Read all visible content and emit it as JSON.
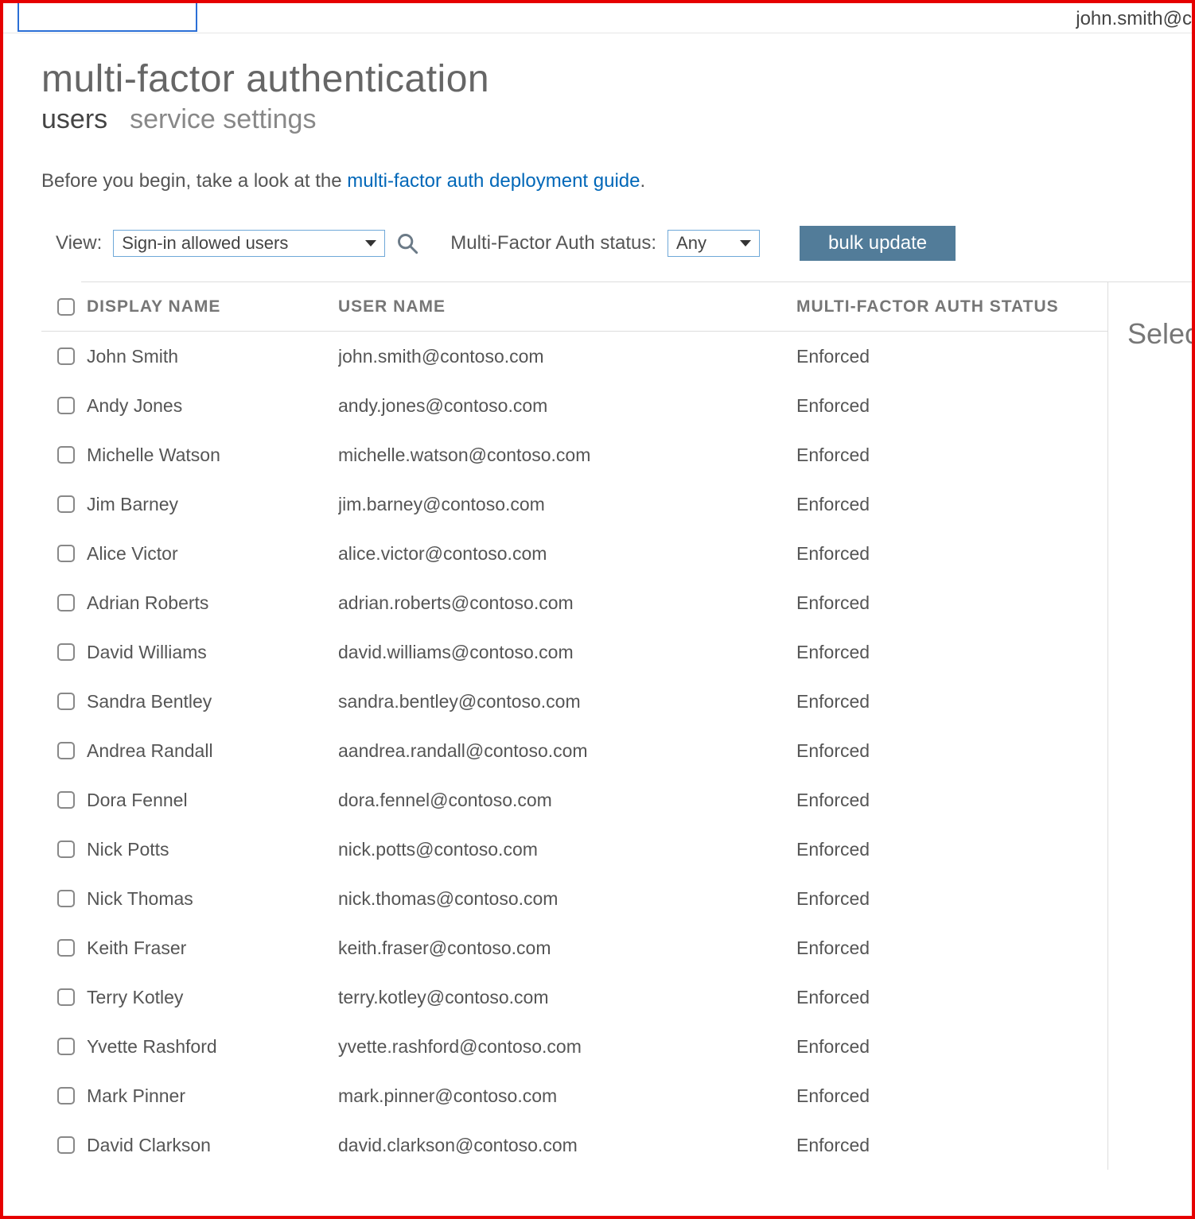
{
  "header": {
    "user_email_truncated": "john.smith@c"
  },
  "page": {
    "title": "multi-factor authentication",
    "tabs": {
      "users": "users",
      "service_settings": "service settings"
    },
    "intro_prefix": "Before you begin, take a look at the ",
    "intro_link": "multi-factor auth deployment guide",
    "intro_suffix": "."
  },
  "filters": {
    "view_label": "View:",
    "view_selected": "Sign-in allowed users",
    "status_label": "Multi-Factor Auth status:",
    "status_selected": "Any",
    "bulk_update": "bulk update"
  },
  "table": {
    "headers": {
      "display_name": "DISPLAY NAME",
      "user_name": "USER NAME",
      "status": "MULTI-FACTOR AUTH STATUS"
    },
    "rows": [
      {
        "display_name": "John Smith",
        "user_name": "john.smith@contoso.com",
        "status": "Enforced"
      },
      {
        "display_name": "Andy Jones",
        "user_name": "andy.jones@contoso.com",
        "status": "Enforced"
      },
      {
        "display_name": "Michelle Watson",
        "user_name": "michelle.watson@contoso.com",
        "status": "Enforced"
      },
      {
        "display_name": "Jim Barney",
        "user_name": "jim.barney@contoso.com",
        "status": "Enforced"
      },
      {
        "display_name": "Alice Victor",
        "user_name": "alice.victor@contoso.com",
        "status": "Enforced"
      },
      {
        "display_name": "Adrian Roberts",
        "user_name": "adrian.roberts@contoso.com",
        "status": "Enforced"
      },
      {
        "display_name": "David Williams",
        "user_name": "david.williams@contoso.com",
        "status": "Enforced"
      },
      {
        "display_name": "Sandra Bentley",
        "user_name": "sandra.bentley@contoso.com",
        "status": "Enforced"
      },
      {
        "display_name": "Andrea Randall",
        "user_name": "aandrea.randall@contoso.com",
        "status": "Enforced"
      },
      {
        "display_name": "Dora Fennel",
        "user_name": "dora.fennel@contoso.com",
        "status": "Enforced"
      },
      {
        "display_name": "Nick Potts",
        "user_name": "nick.potts@contoso.com",
        "status": "Enforced"
      },
      {
        "display_name": "Nick Thomas",
        "user_name": "nick.thomas@contoso.com",
        "status": "Enforced"
      },
      {
        "display_name": "Keith Fraser",
        "user_name": "keith.fraser@contoso.com",
        "status": "Enforced"
      },
      {
        "display_name": "Terry Kotley",
        "user_name": "terry.kotley@contoso.com",
        "status": "Enforced"
      },
      {
        "display_name": "Yvette Rashford",
        "user_name": "yvette.rashford@contoso.com",
        "status": "Enforced"
      },
      {
        "display_name": "Mark Pinner",
        "user_name": "mark.pinner@contoso.com",
        "status": "Enforced"
      },
      {
        "display_name": "David Clarkson",
        "user_name": "david.clarkson@contoso.com",
        "status": "Enforced"
      }
    ]
  },
  "side": {
    "heading_truncated": "Select"
  }
}
